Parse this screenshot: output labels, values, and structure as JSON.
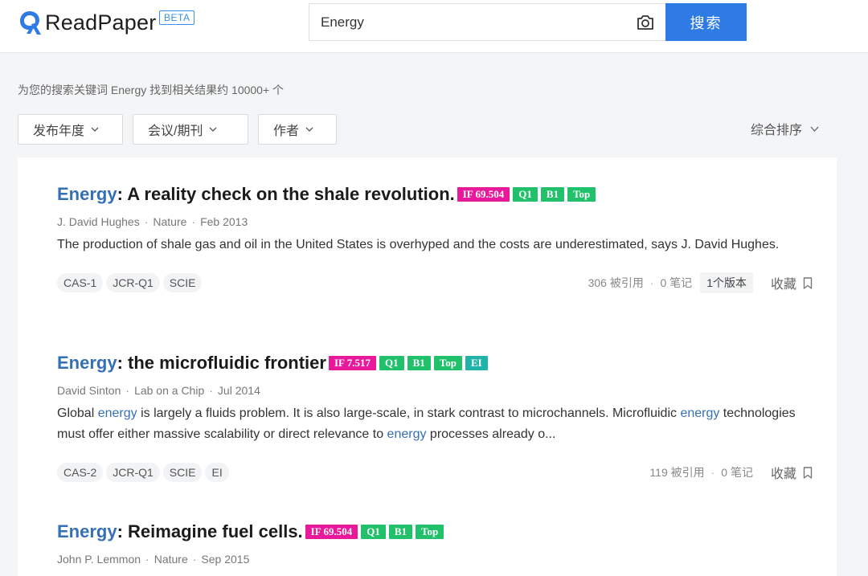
{
  "header": {
    "logo_text": "ReadPaper",
    "beta_label": "BETA",
    "search_value": "Energy",
    "search_button": "搜索",
    "camera_icon": "camera-icon"
  },
  "summary": "为您的搜索关键词 Energy 找到相关结果约 10000+ 个",
  "filters": {
    "year": "发布年度",
    "venue": "会议/期刊",
    "author": "作者",
    "sort": "综合排序"
  },
  "results": [
    {
      "title_kw": "Energy",
      "title_rest": ": A reality check on the shale revolution.",
      "badges": [
        "IF 69.504",
        "Q1",
        "B1",
        "Top"
      ],
      "author": "J. David Hughes",
      "venue": "Nature",
      "date": "Feb 2013",
      "abstract": "The production of shale gas and oil in the United States is overhyped and the costs are underestimated, says J. David Hughes.",
      "tags": [
        "CAS-1",
        "JCR-Q1",
        "SCIE"
      ],
      "citations": "306 被引用",
      "notes": "0 笔记",
      "versions": "1个版本",
      "fav": "收藏"
    },
    {
      "title_kw": "Energy",
      "title_rest": ": the microfluidic frontier",
      "badges": [
        "IF 7.517",
        "Q1",
        "B1",
        "Top",
        "EI"
      ],
      "author": "David Sinton",
      "venue": "Lab on a Chip",
      "date": "Jul 2014",
      "abstract_parts": [
        "Global ",
        "energy",
        " is largely a fluids problem. It is also large-scale, in stark contrast to microchannels. Microfluidic ",
        "energy",
        " technologies must offer either massive scalability or direct relevance to ",
        "energy",
        " processes already o..."
      ],
      "tags": [
        "CAS-2",
        "JCR-Q1",
        "SCIE",
        "EI"
      ],
      "citations": "119 被引用",
      "notes": "0 笔记",
      "fav": "收藏"
    },
    {
      "title_kw": "Energy",
      "title_rest": ": Reimagine fuel cells.",
      "badges": [
        "IF 69.504",
        "Q1",
        "B1",
        "Top"
      ],
      "author": "John P. Lemmon",
      "venue": "Nature",
      "date": "Sep 2015"
    }
  ],
  "colors": {
    "accent": "#2f7be6",
    "keyword": "#3570b5",
    "if_badge": "#e8199b",
    "green_badge": "#21c06b",
    "ei_badge": "#1fb3aa"
  }
}
